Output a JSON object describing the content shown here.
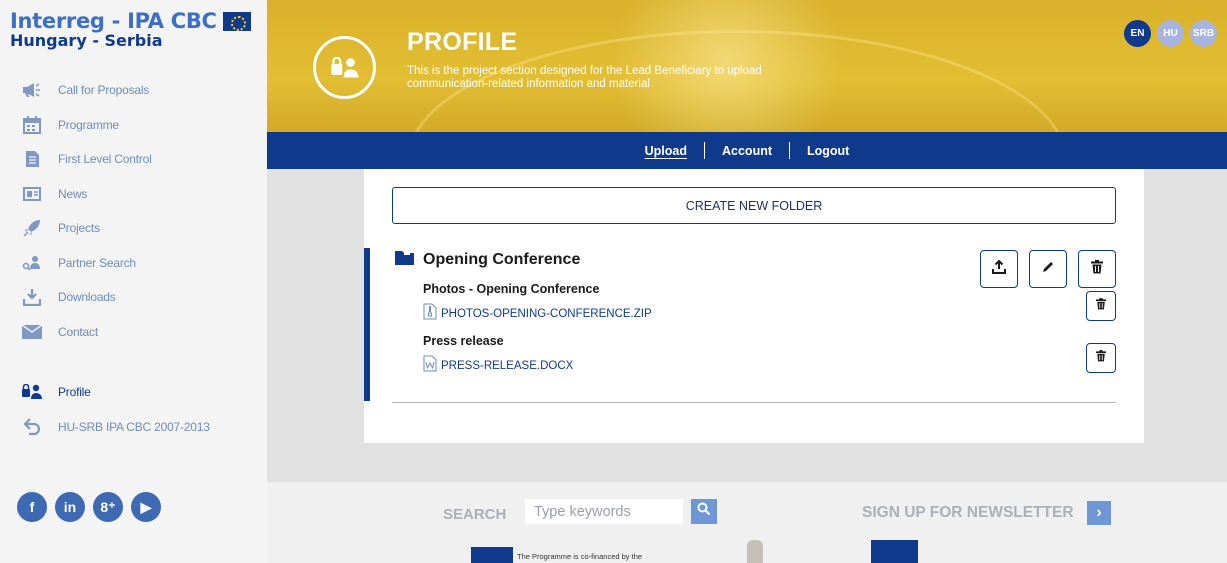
{
  "logo": {
    "line1": "Interreg - IPA CBC",
    "line2": "Hungary - Serbia"
  },
  "sidebar": {
    "items": [
      {
        "label": "Call for Proposals",
        "icon": "megaphone-icon"
      },
      {
        "label": "Programme",
        "icon": "calendar-icon"
      },
      {
        "label": "First Level Control",
        "icon": "document-icon"
      },
      {
        "label": "News",
        "icon": "newspaper-icon"
      },
      {
        "label": "Projects",
        "icon": "rocket-icon"
      },
      {
        "label": "Partner Search",
        "icon": "partner-search-icon"
      },
      {
        "label": "Downloads",
        "icon": "download-icon"
      },
      {
        "label": "Contact",
        "icon": "envelope-icon"
      }
    ],
    "secondary": [
      {
        "label": "Profile",
        "icon": "profile-icon",
        "active": true
      },
      {
        "label": "HU-SRB IPA CBC 2007-2013",
        "icon": "back-arrow-icon"
      }
    ],
    "social": [
      {
        "label": "f",
        "icon": "facebook-icon"
      },
      {
        "label": "in",
        "icon": "linkedin-icon"
      },
      {
        "label": "8⁺",
        "icon": "google-plus-icon"
      },
      {
        "label": "▶",
        "icon": "youtube-icon"
      }
    ]
  },
  "hero": {
    "title": "PROFILE",
    "subtitle": "This is the project section designed for the Lead Beneficiary to upload communication-related information and material"
  },
  "languages": [
    {
      "code": "EN",
      "active": true
    },
    {
      "code": "HU",
      "active": false
    },
    {
      "code": "SRB",
      "active": false
    }
  ],
  "tabs": [
    {
      "label": "Upload",
      "active": true
    },
    {
      "label": "Account",
      "active": false
    },
    {
      "label": "Logout",
      "active": false
    }
  ],
  "main": {
    "create_folder_label": "CREATE NEW FOLDER",
    "folder": {
      "title": "Opening Conference",
      "items": [
        {
          "title": "Photos - Opening Conference",
          "file": "PHOTOS-OPENING-CONFERENCE.ZIP",
          "file_icon": "zip-file-icon"
        },
        {
          "title": "Press release",
          "file": "PRESS-RELEASE.DOCX",
          "file_icon": "word-file-icon"
        }
      ]
    }
  },
  "footer": {
    "search_label": "SEARCH",
    "search_placeholder": "Type keywords",
    "newsletter_label": "SIGN UP FOR NEWSLETTER",
    "eu_text": "The Programme is co-financed by the"
  },
  "colors": {
    "brand_blue": "#0f3a8c",
    "hero_yellow": "#e0b82f",
    "link_blue": "#6e8db8"
  }
}
